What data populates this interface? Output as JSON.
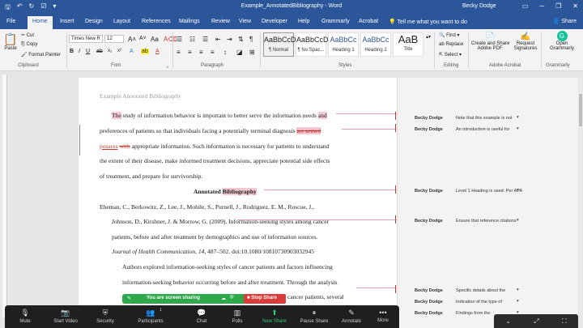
{
  "window": {
    "title": "Example_AnnotatedBibliography - Word",
    "user": "Becky Dodge"
  },
  "tabs": [
    "File",
    "Home",
    "Insert",
    "Design",
    "Layout",
    "References",
    "Mailings",
    "Review",
    "View",
    "Developer",
    "Help",
    "Grammarly",
    "Acrobat"
  ],
  "tell_me": "Tell me what you want to do",
  "share_label": "Share",
  "ribbon": {
    "clipboard": {
      "paste": "Paste",
      "cut": "Cut",
      "copy": "Copy",
      "format_painter": "Format Painter",
      "label": "Clipboard"
    },
    "font": {
      "name": "Times New R",
      "size": "12",
      "label": "Font"
    },
    "paragraph": {
      "label": "Paragraph"
    },
    "styles": {
      "label": "Styles",
      "items": [
        {
          "preview": "AaBbCcD",
          "name": "¶ Normal"
        },
        {
          "preview": "AaBbCcD",
          "name": "¶ No Spac..."
        },
        {
          "preview": "AaBbCc",
          "name": "Heading 1"
        },
        {
          "preview": "AaBbCc",
          "name": "Heading 2"
        },
        {
          "preview": "AaB",
          "name": "Title"
        }
      ]
    },
    "editing": {
      "find": "Find",
      "replace": "Replace",
      "select": "Select",
      "label": "Editing"
    },
    "acrobat": {
      "create_share": "Create and Share",
      "adobe_pdf": "Adobe PDF",
      "request": "Request",
      "signatures": "Signatures",
      "label": "Adobe Acrobat"
    },
    "grammarly": {
      "open": "Open",
      "grammarly": "Grammarly",
      "label": "Grammarly"
    }
  },
  "document": {
    "header": "Example Annotated Bibliography",
    "p1": {
      "hl_the": "The",
      "l1_rest": " study of information behavior is important to better serve the information needs ",
      "l1_and": "and",
      "l2_a": "preferences of  patients so that individuals facing a potentially terminal diagnosis ",
      "l2_armed": "are armed",
      "l3_possess": "possess",
      "l3_with": "with",
      "l3_rest": " appropriate information. Such information is necessary for patients to understand",
      "l4": "the extent of their disease, make informed treatment decisions, appreciate potential side effects",
      "l5": "of treatment, and prepare for survivorship."
    },
    "heading_a": "Annotated ",
    "heading_b": "Bibliography",
    "ref": {
      "l1": "Eheman, C., Berkowitz, Z., Lee, J., Mohile, S., Purnell, J., Rodriguez, E. M., Roscoe, J.,",
      "l2": "Johnson, D., Kirshner, J. & Morrow, G. (2009). Information-seeking styles among cancer",
      "l3": "patients, before and after treatment by demographics and use of information sources.",
      "l4_journal": "Journal of Health Communication, 14",
      "l4_rest": ", 487–502. doi:10.1080/10810730903032945"
    },
    "annot": {
      "l1": "Authors explored information-seeking styles of cancer patients and factors influencing",
      "l2": "information-seeking behavior occurring before and after treatment. Through the analysis",
      "l3": "cancer patients, several"
    }
  },
  "comments": [
    {
      "author": "Becky Dodge",
      "text": "Note that this example is not"
    },
    {
      "author": "Becky Dodge",
      "text": "An introduction is useful for"
    },
    {
      "author": "Becky Dodge",
      "text": "Level 1 Heading is used. Per APA"
    },
    {
      "author": "Becky Dodge",
      "text": "Ensure that reference citations"
    },
    {
      "author": "Becky Dodge",
      "text": "Specific details about the"
    },
    {
      "author": "Becky Dodge",
      "text": "Indication of the type of"
    },
    {
      "author": "Becky Dodge",
      "text": "Findings from the"
    }
  ],
  "sharing": {
    "label": "You are screen sharing",
    "stop": "Stop Share"
  },
  "zoom": {
    "participants_count": "1",
    "items": [
      "Mute",
      "Start Video",
      "Security",
      "Participants",
      "Chat",
      "Polls",
      "New Share",
      "Pause Share",
      "Annotate",
      "More"
    ]
  }
}
